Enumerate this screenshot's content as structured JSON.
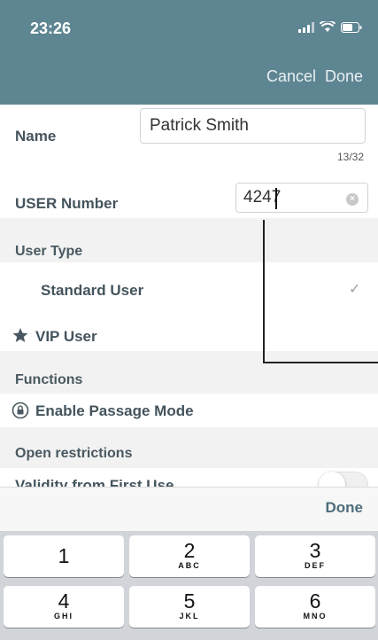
{
  "status_bar": {
    "time": "23:26"
  },
  "nav": {
    "cancel_label": "Cancel",
    "done_label": "Done"
  },
  "form": {
    "name_label": "Name",
    "name_value": "Patrick Smith",
    "name_counter": "13/32",
    "user_number_label": "USER Number",
    "user_number_value": "4247"
  },
  "sections": {
    "user_type": "User Type",
    "functions": "Functions",
    "open_restrictions": "Open restrictions"
  },
  "user_types": {
    "standard": "Standard User",
    "vip": "VIP User"
  },
  "functions": {
    "passage_mode": "Enable Passage Mode"
  },
  "restrictions": {
    "validity_partial": "Validity from First Use"
  },
  "keyboard": {
    "done_label": "Done",
    "keys": [
      {
        "num": "1",
        "letters": ""
      },
      {
        "num": "2",
        "letters": "ABC"
      },
      {
        "num": "3",
        "letters": "DEF"
      },
      {
        "num": "4",
        "letters": "GHI"
      },
      {
        "num": "5",
        "letters": "JKL"
      },
      {
        "num": "6",
        "letters": "MNO"
      }
    ]
  },
  "colors": {
    "header_bg": "#5e8592",
    "section_bg": "#f2f2f2",
    "accent": "#4d6d7a"
  }
}
